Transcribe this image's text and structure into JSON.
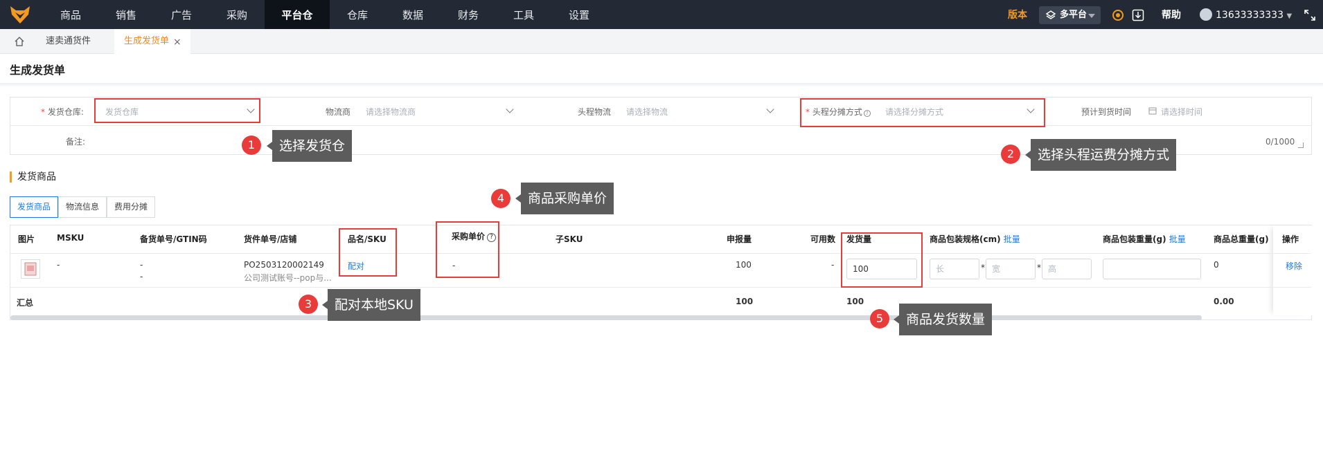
{
  "nav": {
    "items": [
      "商品",
      "销售",
      "广告",
      "采购",
      "平台仓",
      "仓库",
      "数据",
      "财务",
      "工具",
      "设置"
    ],
    "active": "平台仓",
    "version": "版本",
    "platform": "多平台",
    "help": "帮助",
    "user": "13633333333"
  },
  "tabs": {
    "items": [
      "速卖通货件",
      "生成发货单"
    ],
    "active": "生成发货单",
    "close": "×"
  },
  "page": {
    "title": "生成发货单"
  },
  "form": {
    "warehouse_label": "发货仓库:",
    "warehouse_placeholder": "发货仓库",
    "logistics_label": "物流商",
    "logistics_placeholder": "请选择物流商",
    "headhaul_label": "头程物流",
    "headhaul_placeholder": "请选择物流",
    "allocation_label": "头程分摊方式",
    "allocation_placeholder": "请选择分摊方式",
    "arrival_label": "预计到货时间",
    "arrival_placeholder": "请选择时间",
    "remark_label": "备注:",
    "remark_count": "0/1000"
  },
  "section": {
    "title": "发货商品"
  },
  "subtabs": [
    "发货商品",
    "物流信息",
    "费用分摊"
  ],
  "table": {
    "headers": {
      "image": "图片",
      "msku": "MSKU",
      "gtin": "备货单号/GTIN码",
      "order_store": "货件单号/店铺",
      "name_sku": "品名/SKU",
      "unit_price": "采购单价",
      "child_sku": "子SKU",
      "declared": "申报量",
      "available": "可用数",
      "ship_qty": "发货量",
      "pack_spec": "商品包装规格(cm)",
      "pack_spec_batch": "批量",
      "pack_weight": "商品包装重量(g)",
      "pack_weight_batch": "批量",
      "total_weight": "商品总重量(g)",
      "ops": "操作"
    },
    "row": {
      "msku": "-",
      "gtin_1": "-",
      "gtin_2": "-",
      "order_no": "PO2503120002149",
      "store": "公司测试账号--pop与...",
      "name_sku_link": "配对",
      "unit_price": "-",
      "declared": "100",
      "available": "-",
      "ship_qty": "100",
      "length_ph": "长",
      "width_ph": "宽",
      "height_ph": "高",
      "star": "*",
      "total_weight": "0",
      "remove": "移除"
    },
    "summary": {
      "label": "汇总",
      "declared": "100",
      "ship_qty": "100",
      "total_weight": "0.00"
    }
  },
  "annotations": [
    {
      "num": "1",
      "text": "选择发货仓"
    },
    {
      "num": "2",
      "text": "选择头程运费分摊方式"
    },
    {
      "num": "3",
      "text": "配对本地SKU"
    },
    {
      "num": "4",
      "text": "商品采购单价"
    },
    {
      "num": "5",
      "text": "商品发货数量"
    }
  ],
  "colors": {
    "topbar": "#232a35",
    "accent_orange": "#f08a24",
    "link_blue": "#1b7be3",
    "annotation_red": "#ea3b3b",
    "tooltip_gray": "#5c5c5c"
  }
}
